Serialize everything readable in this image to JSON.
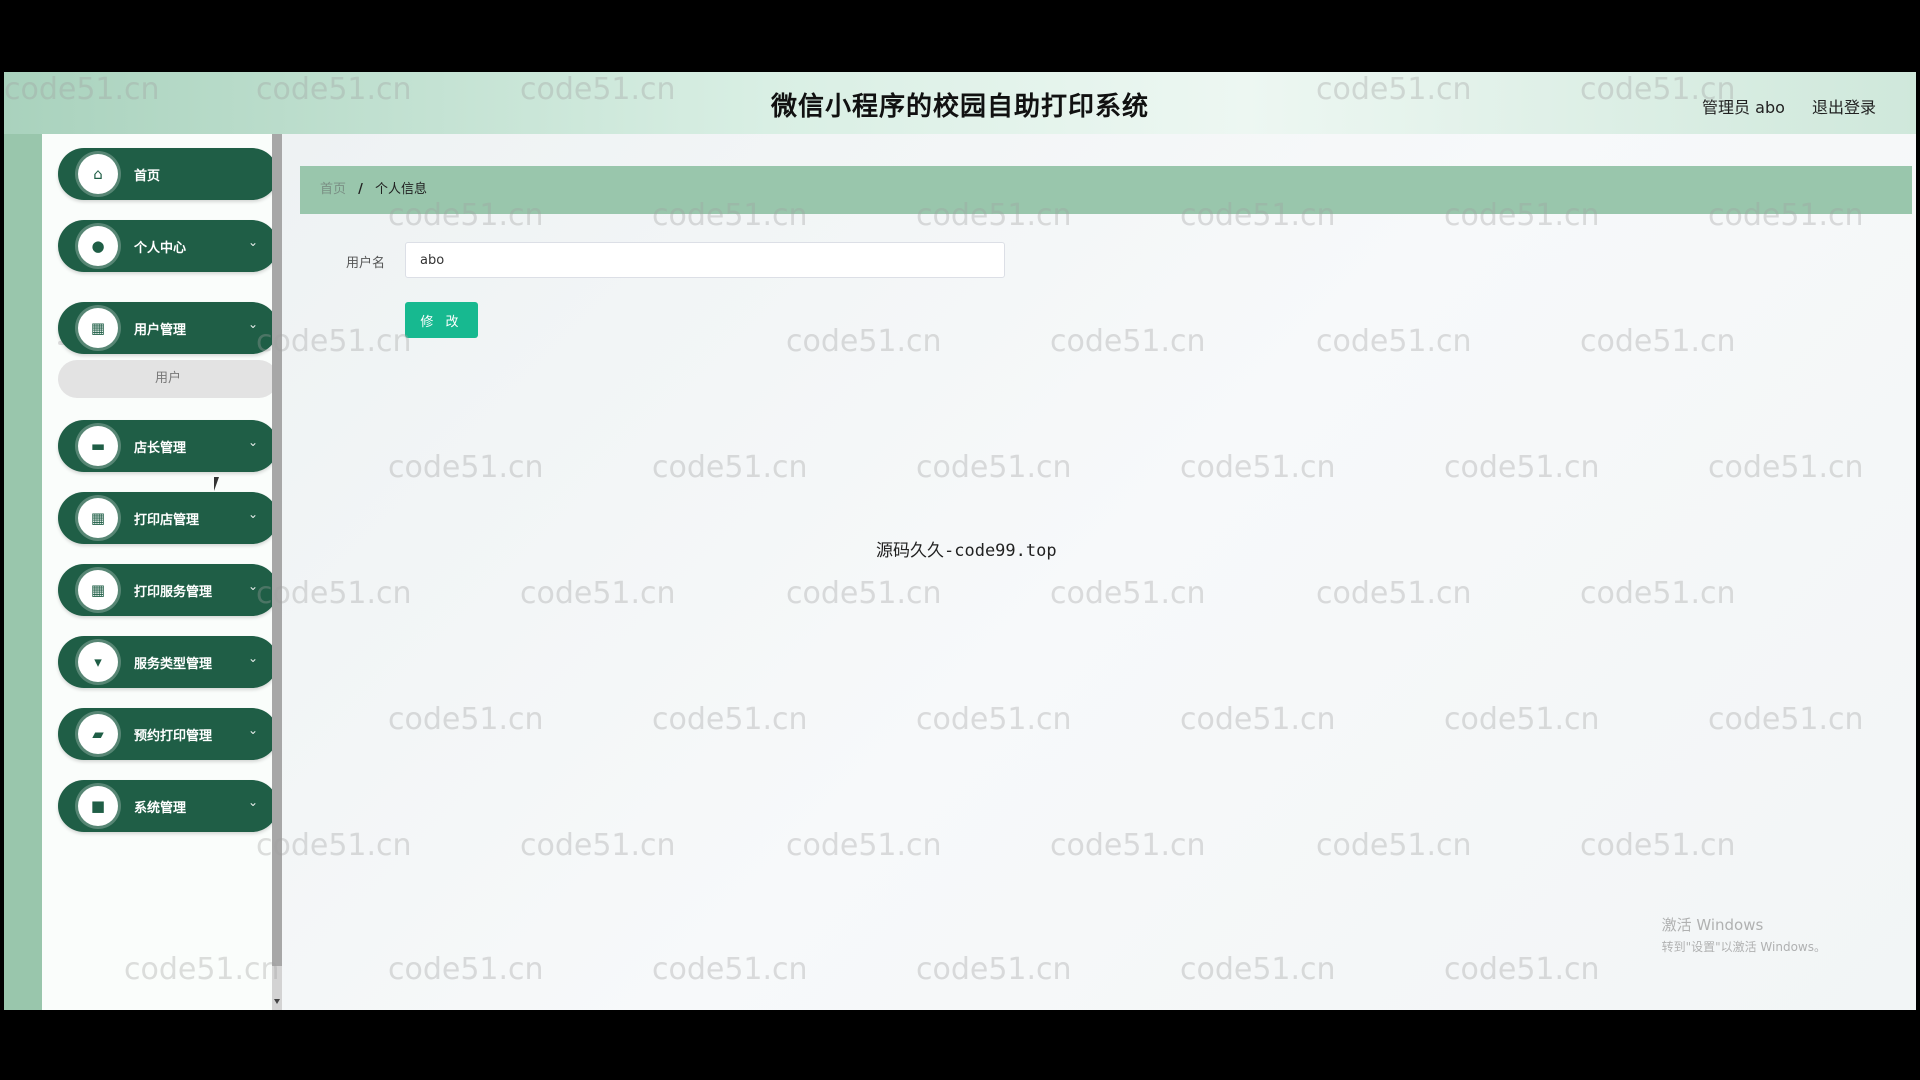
{
  "header": {
    "title": "微信小程序的校园自助打印系统",
    "admin": "管理员 abo",
    "logout": "退出登录"
  },
  "sidebar": {
    "items": [
      {
        "label": "首页",
        "icon": "home-icon",
        "glyph": "⌂"
      },
      {
        "label": "个人中心",
        "icon": "user-icon",
        "glyph": "●"
      },
      {
        "label": "用户管理",
        "icon": "grid-icon",
        "glyph": "▦"
      },
      {
        "label": "店长管理",
        "icon": "briefcase-icon",
        "glyph": "▬"
      },
      {
        "label": "打印店管理",
        "icon": "grid-icon",
        "glyph": "▦"
      },
      {
        "label": "打印服务管理",
        "icon": "grid-icon",
        "glyph": "▦"
      },
      {
        "label": "服务类型管理",
        "icon": "pin-icon",
        "glyph": "▾"
      },
      {
        "label": "预约打印管理",
        "icon": "cart-icon",
        "glyph": "▰"
      },
      {
        "label": "系统管理",
        "icon": "video-icon",
        "glyph": "■"
      }
    ],
    "submenu": {
      "label": "用户"
    }
  },
  "breadcrumb": {
    "home": "首页",
    "separator": "/",
    "current": "个人信息"
  },
  "form": {
    "username_label": "用户名",
    "username_value": "abo",
    "submit_label": "修 改"
  },
  "watermarks": {
    "site": "code51.cn",
    "center": "源码久久-code99.top"
  },
  "windows_activation": {
    "line1": "激活 Windows",
    "line2": "转到\"设置\"以激活 Windows。"
  }
}
